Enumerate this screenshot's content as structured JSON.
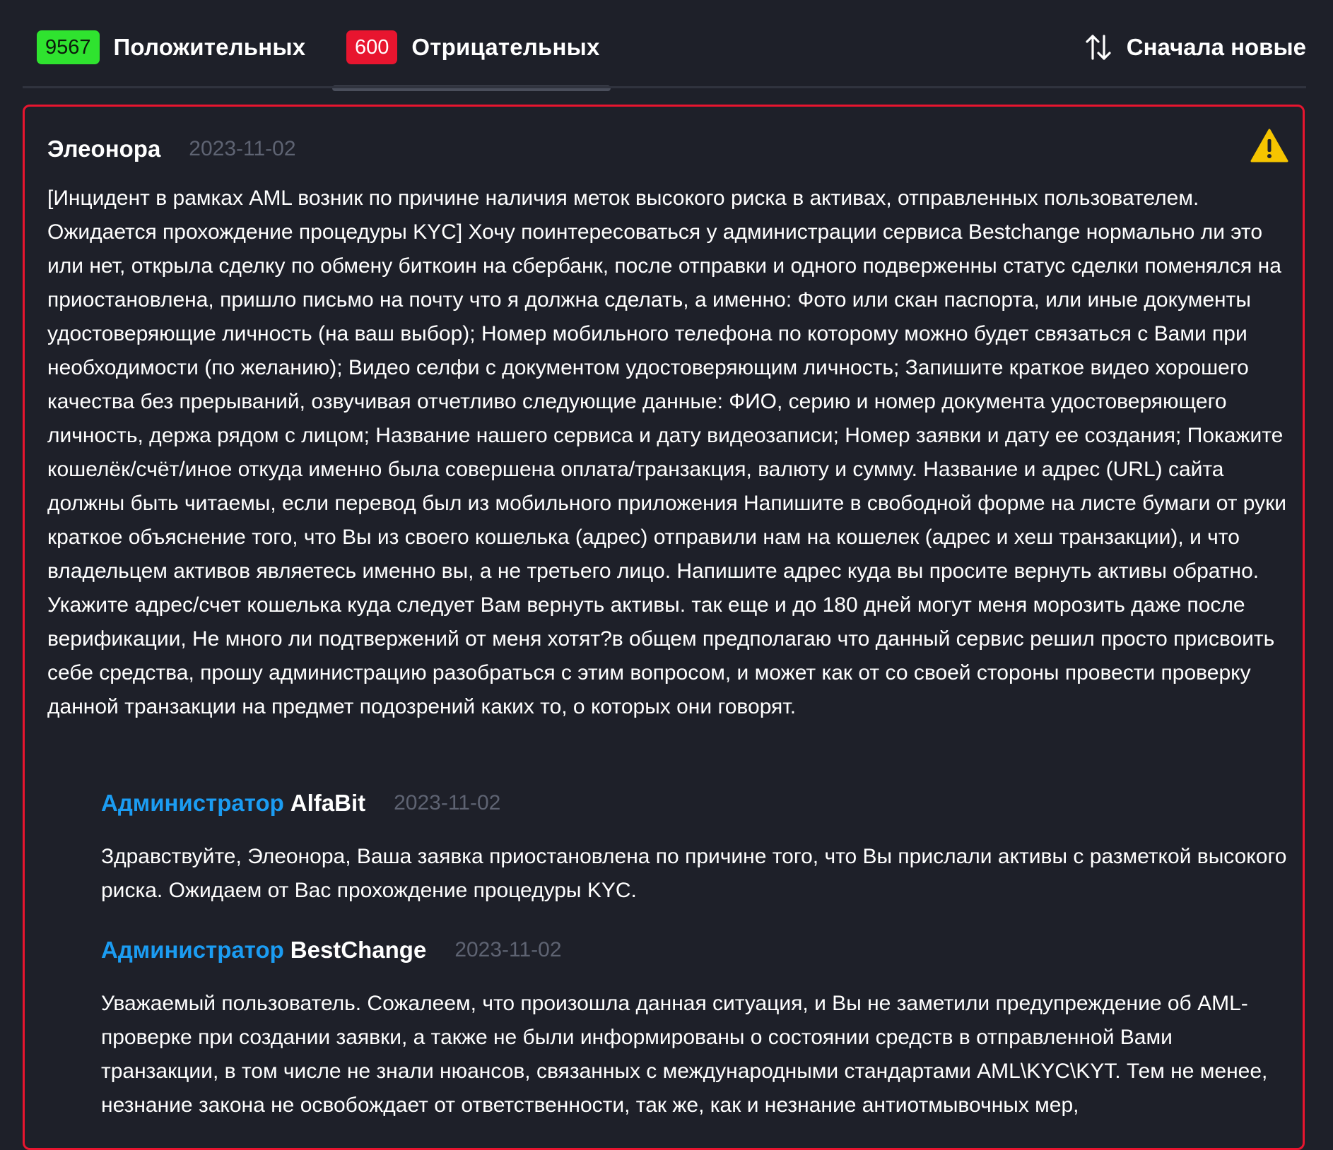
{
  "tabs": {
    "positive": {
      "count": "9567",
      "label": "Положительных"
    },
    "negative": {
      "count": "600",
      "label": "Отрицательных"
    },
    "sort_label": "Сначала новые",
    "sort_icon": "sort-arrows-icon"
  },
  "colors": {
    "positive_badge": "#2fe32f",
    "negative_badge": "#e8152f",
    "card_border": "#e8152f",
    "admin_role": "#1b9cf2",
    "date_text": "#5e6372",
    "warning": "#f5c400"
  },
  "review": {
    "author": "Элеонора",
    "date": "2023-11-02",
    "status_icon": "warning-icon",
    "text": "[Инцидент в рамках AML возник по причине наличия меток высокого риска в активах, отправленных пользователем. Ожидается прохождение процедуры KYC] Хочу поинтересоваться у администрации сервиса Bestchange нормально ли это или нет, открыла сделку по обмену биткоин на сбербанк, после отправки и одного подверженны статус сделки поменялся на приостановлена, пришло письмо на почту что я должна сделать, а именно: Фото или скан паспорта, или иные документы удостоверяющие личность (на ваш выбор); Номер мобильного телефона по которому можно будет связаться с Вами при необходимости (по желанию); Видео селфи с документом удостоверяющим личность; Запишите краткое видео хорошего качества без прерываний, озвучивая отчетливо следующие данные: ФИО, серию и номер документа удостоверяющего личность, держа рядом с лицом; Название нашего сервиса и дату видеозаписи; Номер заявки и дату ее создания; Покажите кошелёк/счёт/иное откуда именно была совершена оплата/транзакция, валюту и сумму. Название и адрес (URL) сайта должны быть читаемы, если перевод был из мобильного приложения Напишите в свободной форме на листе бумаги от руки краткое объяснение того, что Вы из своего кошелька (адрес) отправили нам на кошелек (адрес и хеш транзакции), и что владельцем активов являетесь именно вы, а не третьего лицо. Напишите адрес куда вы просите вернуть активы обратно. Укажите адрес/счет кошелька куда следует Вам вернуть активы. так еще и до 180 дней могут меня морозить даже после верификации, Не много ли подтвержений от меня хотят?в общем предполагаю что данный сервис решил просто присвоить себе средства, прошу администрацию разобраться с этим вопросом, и может как от со своей стороны провести проверку данной транзакции на предмет подозрений каких то, о которых они говорят."
  },
  "replies": [
    {
      "role": "Администратор",
      "org": "AlfaBit",
      "date": "2023-11-02",
      "text": "Здравствуйте, Элеонора, Ваша заявка приостановлена по причине того, что Вы прислали активы с разметкой высокого риска. Ожидаем от Вас прохождение процедуры KYC."
    },
    {
      "role": "Администратор",
      "org": "BestChange",
      "date": "2023-11-02",
      "text": "Уважаемый пользователь. Сожалеем, что произошла данная ситуация, и Вы не заметили предупреждение об AML-проверке при создании заявки, а также не были информированы о состоянии средств в отправленной Вами транзакции, в том числе не знали нюансов, связанных с международными стандартами AML\\KYC\\KYT. Тем не менее, незнание закона не освобождает от ответственности, так же, как и незнание антиотмывочных мер,"
    }
  ]
}
